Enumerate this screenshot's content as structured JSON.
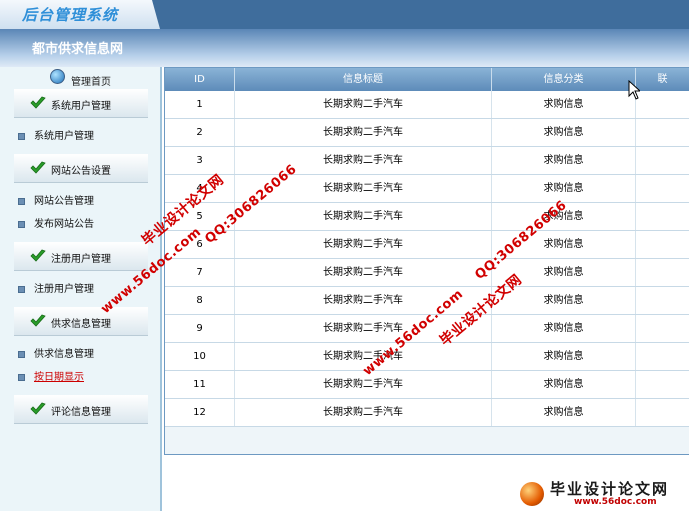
{
  "header": {
    "app_title": "后台管理系统",
    "site_title": "都市供求信息网"
  },
  "sidebar": {
    "home_label": "管理首页",
    "sections": [
      {
        "label": "系统用户管理",
        "items": [
          "系统用户管理"
        ]
      },
      {
        "label": "网站公告设置",
        "items": [
          "网站公告管理",
          "发布网站公告"
        ]
      },
      {
        "label": "注册用户管理",
        "items": [
          "注册用户管理"
        ]
      },
      {
        "label": "供求信息管理",
        "items": [
          "供求信息管理",
          "按日期显示"
        ]
      },
      {
        "label": "评论信息管理",
        "items": []
      }
    ],
    "active_item": "按日期显示"
  },
  "table": {
    "columns": [
      "ID",
      "信息标题",
      "信息分类",
      "联"
    ],
    "rows": [
      [
        "1",
        "长期求购二手汽车",
        "求购信息"
      ],
      [
        "2",
        "长期求购二手汽车",
        "求购信息"
      ],
      [
        "3",
        "长期求购二手汽车",
        "求购信息"
      ],
      [
        "4",
        "长期求购二手汽车",
        "求购信息"
      ],
      [
        "5",
        "长期求购二手汽车",
        "求购信息"
      ],
      [
        "6",
        "长期求购二手汽车",
        "求购信息"
      ],
      [
        "7",
        "长期求购二手汽车",
        "求购信息"
      ],
      [
        "8",
        "长期求购二手汽车",
        "求购信息"
      ],
      [
        "9",
        "长期求购二手汽车",
        "求购信息"
      ],
      [
        "10",
        "长期求购二手汽车",
        "求购信息"
      ],
      [
        "11",
        "长期求购二手汽车",
        "求购信息"
      ],
      [
        "12",
        "长期求购二手汽车",
        "求购信息"
      ]
    ]
  },
  "watermark": {
    "site_name": "毕业设计论文网",
    "qq": "QQ:306826066",
    "url": "www.56doc.com",
    "footer_name": "毕业设计论文网",
    "footer_url": "www.56doc.com"
  },
  "colors": {
    "header_bar": "#3f6d9c",
    "sidebar_bg": "#ebf5f9",
    "table_header": "#6f9cc6",
    "watermark_red": "#d10000",
    "active_link": "#cc0000"
  }
}
